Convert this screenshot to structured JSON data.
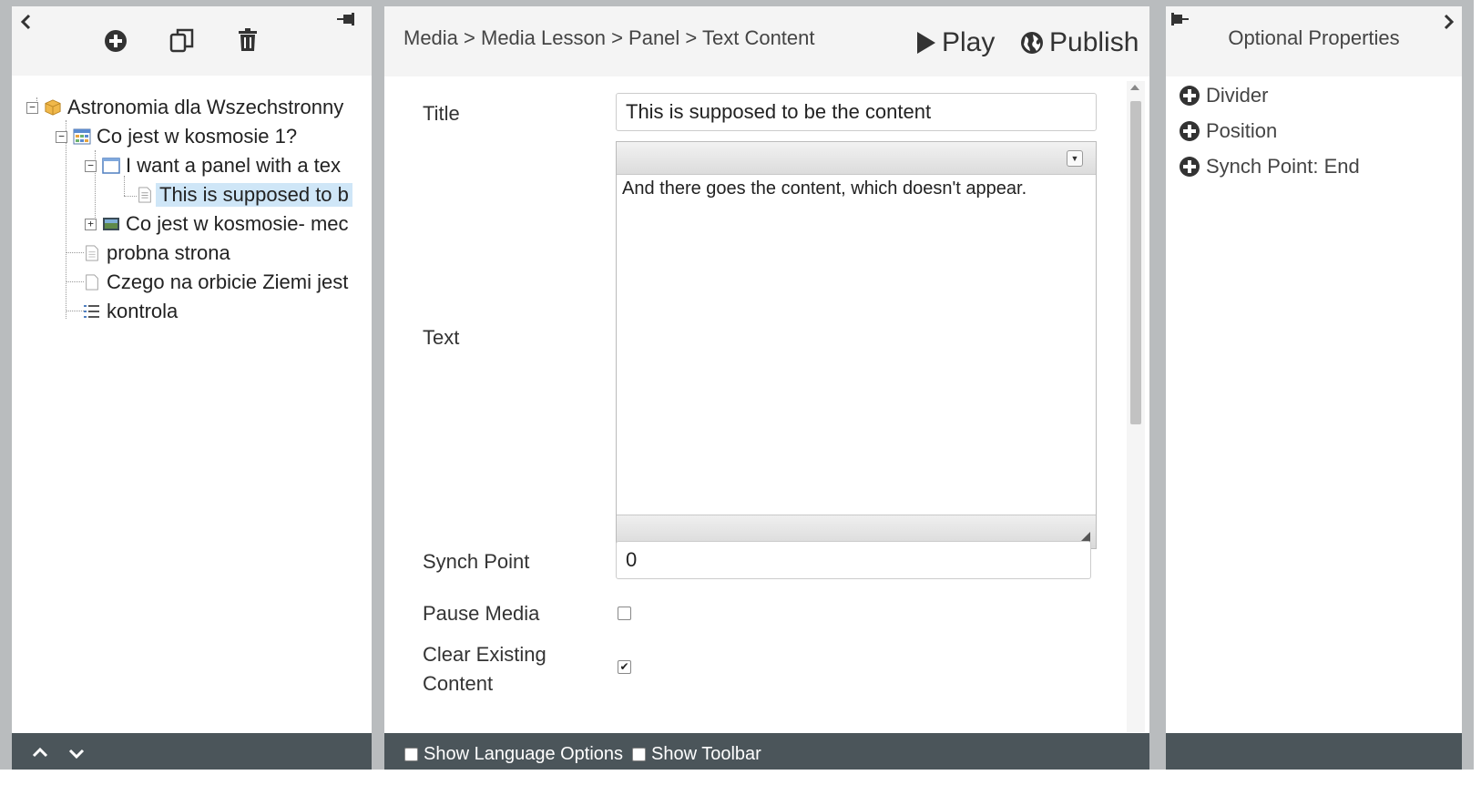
{
  "left_panel": {
    "tree": [
      {
        "label": "Astronomia dla Wszechstronny",
        "icon": "package-icon"
      },
      {
        "label": "Co jest w kosmosie 1?",
        "icon": "grid-page-icon"
      },
      {
        "label": "I want a panel with a tex",
        "icon": "panel-icon"
      },
      {
        "label": "This is supposed to b",
        "icon": "text-page-icon"
      },
      {
        "label": "Co jest w kosmosie- mec",
        "icon": "media-lesson-icon"
      },
      {
        "label": "probna strona",
        "icon": "page-icon"
      },
      {
        "label": "Czego na orbicie Ziemi jest",
        "icon": "blank-page-icon"
      },
      {
        "label": "kontrola",
        "icon": "list-icon"
      }
    ]
  },
  "header": {
    "breadcrumb": "Media > Media Lesson > Panel > Text Content",
    "play_label": "Play",
    "publish_label": "Publish"
  },
  "form": {
    "title_label": "Title",
    "title_value": "This is supposed to be the content",
    "text_label": "Text",
    "text_value": "And there goes the content, which doesn't appear.",
    "synch_label": "Synch Point",
    "synch_value": "0",
    "pause_label": "Pause Media",
    "pause_checked": false,
    "clear_label_1": "Clear Existing",
    "clear_label_2": "Content",
    "clear_checked": true
  },
  "footer": {
    "show_language_label": "Show Language Options",
    "show_toolbar_label": "Show Toolbar"
  },
  "right_panel": {
    "title": "Optional Properties",
    "items": [
      "Divider",
      "Position",
      "Synch Point: End"
    ]
  },
  "colors": {
    "footer_bg": "#4b555a",
    "selection_bg": "#cfe6f7",
    "frame_bg": "#b9bcbe"
  }
}
